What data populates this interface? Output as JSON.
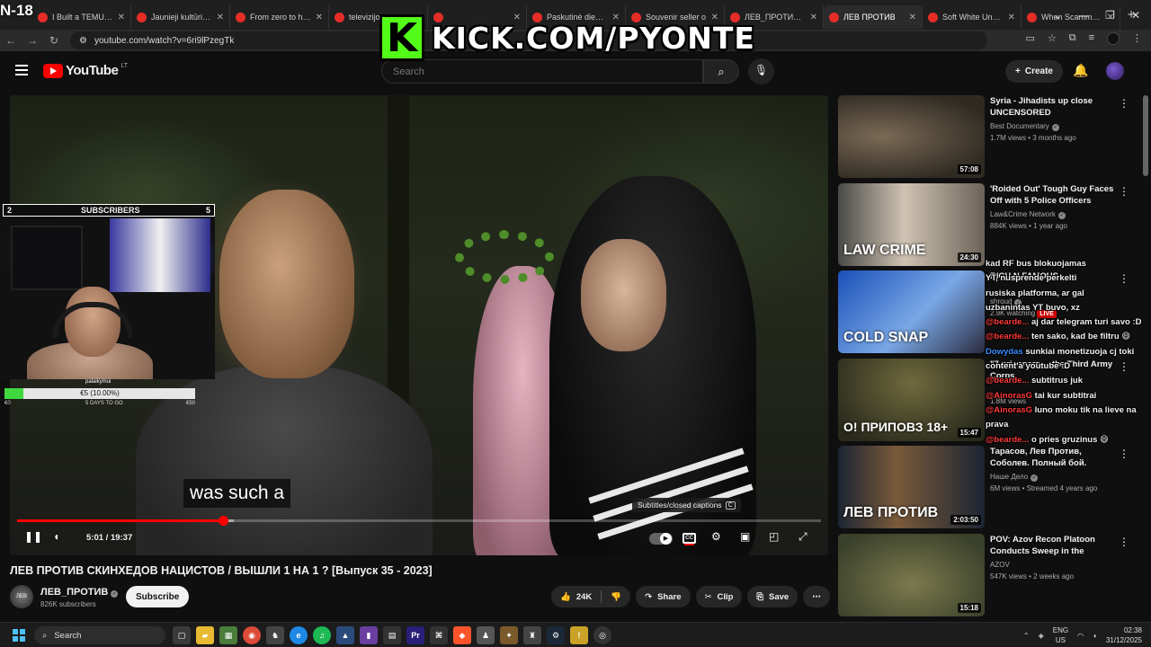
{
  "overlay": {
    "age_badge": "N-18",
    "kick_logo": "K",
    "kick_text": "KICK.COM/PYONTE"
  },
  "browser": {
    "tabs": [
      {
        "title": "I Built a TEMU Onl",
        "active": false
      },
      {
        "title": "Jaunieji kultūrizm",
        "active": false
      },
      {
        "title": "From zero to hero",
        "active": false
      },
      {
        "title": "televizijos",
        "active": false
      },
      {
        "title": "",
        "active": false
      },
      {
        "title": "Paskutinė diena -",
        "active": false
      },
      {
        "title": "Souvenir seller o",
        "active": false
      },
      {
        "title": "ЛЕВ_ПРОТИВ - Yo",
        "active": false
      },
      {
        "title": "ЛЕВ ПРОТИВ",
        "active": true
      },
      {
        "title": "Soft White Under",
        "active": false
      },
      {
        "title": "When Scammers",
        "active": false
      }
    ],
    "new_tab": "+",
    "url": "youtube.com/watch?v=6ri9lPzegTk"
  },
  "youtube": {
    "logo_text": "YouTube",
    "country": "LT",
    "search_placeholder": "Search",
    "create_label": "Create"
  },
  "player": {
    "caption_text": "was such a",
    "tooltip": "Subtitles/closed captions",
    "tooltip_key": "C",
    "time_current": "5:01",
    "time_total": "19:37",
    "progress": 0.256,
    "buffered": 0.27
  },
  "webcam": {
    "sub_count_left": "2",
    "sub_label": "SUBSCRIBERS",
    "sub_count_right": "5",
    "goal_name": "palaikymui",
    "goal_text": "€5 (10.00%)",
    "goal_fraction": 0.1,
    "goal_low": "€0",
    "goal_days": "5 DAYS TO GO",
    "goal_high": "€50"
  },
  "video": {
    "title": "ЛЕВ ПРОТИВ СКИНХЕДОВ НАЦИСТОВ / ВЫШЛИ 1 НА 1 ? [Выпуск 35 - 2023]",
    "channel": "ЛЕВ_ПРОТИВ",
    "subscribers": "826K subscribers",
    "subscribe_label": "Subscribe",
    "likes": "24K",
    "share_label": "Share",
    "clip_label": "Clip",
    "save_label": "Save"
  },
  "recommendations": [
    {
      "title": "Syria - Jihadists up close UNCENSORED",
      "channel": "Best Documentary",
      "meta": "1.7M views • 3 months ago",
      "duration": "57:08",
      "verified": true
    },
    {
      "title": "'Roided Out' Tough Guy Faces Off with 5 Police Officers",
      "channel": "Law&Crime Network",
      "meta": "884K views • 1 year ago",
      "duration": "24:30",
      "verified": true,
      "thumb_text": "LAW CRIME"
    },
    {
      "title": "RICH N FAMOUS",
      "channel": "shroud",
      "meta": "2.9K watching",
      "duration": "",
      "verified": true,
      "live": "LIVE",
      "thumb_text": "COLD SNAP"
    },
    {
      "title": "\"7 prisoners ... the Third Army Corps",
      "channel": "",
      "meta": "1.8M views",
      "duration": "15:47",
      "verified": false,
      "thumb_text": "О! ПРИПОВЗ 18+"
    },
    {
      "title": "Тарасов, Лев Против, Соболев. Полный бой. Чипинкос ...",
      "channel": "Наше Дело",
      "meta": "6M views • Streamed 4 years ago",
      "duration": "2:03:50",
      "verified": true,
      "thumb_text": "ЛЕВ ПРОТИВ"
    },
    {
      "title": "POV: Azov Recon Platoon Conducts Sweep in the Toretsk ...",
      "channel": "AZOV",
      "meta": "547K views • 2 weeks ago",
      "duration": "15:18",
      "verified": false
    }
  ],
  "chat": [
    {
      "user": "",
      "text": "kad RF bus blokuojamas"
    },
    {
      "user": "",
      "text": "YT, nusprende perkelti"
    },
    {
      "user": "",
      "text": "rusiska platforma, ar gal"
    },
    {
      "user": "",
      "text": "uzbanintas YT buvo, xz"
    },
    {
      "user": "@bearde...",
      "text": "aj dar telegram turi savo :D"
    },
    {
      "user": "@bearde...",
      "text": "ten sako, kad be filtru 😄"
    },
    {
      "user": "Dowydas",
      "text": "sunkiai monetizuoja cj toki",
      "blue": true
    },
    {
      "user": "",
      "text": "content'a youtube :D"
    },
    {
      "user": "@bearde...",
      "text": "subtitrus juk"
    },
    {
      "user": "@AinorasG",
      "text": "tai kur subtitrai"
    },
    {
      "user": "@AinorasG",
      "text": "luno moku tik na lieve na"
    },
    {
      "user": "",
      "text": "prava"
    },
    {
      "user": "@bearde...",
      "text": "o pries gruzinus 😄"
    }
  ],
  "taskbar": {
    "search_placeholder": "Search",
    "lang": "ENG",
    "region": "US",
    "time": "02:38",
    "date": "31/12/2025"
  },
  "colors": {
    "youtube_red": "#ff0000",
    "kick_green": "#53fc18",
    "bg": "#0f0f0f"
  }
}
